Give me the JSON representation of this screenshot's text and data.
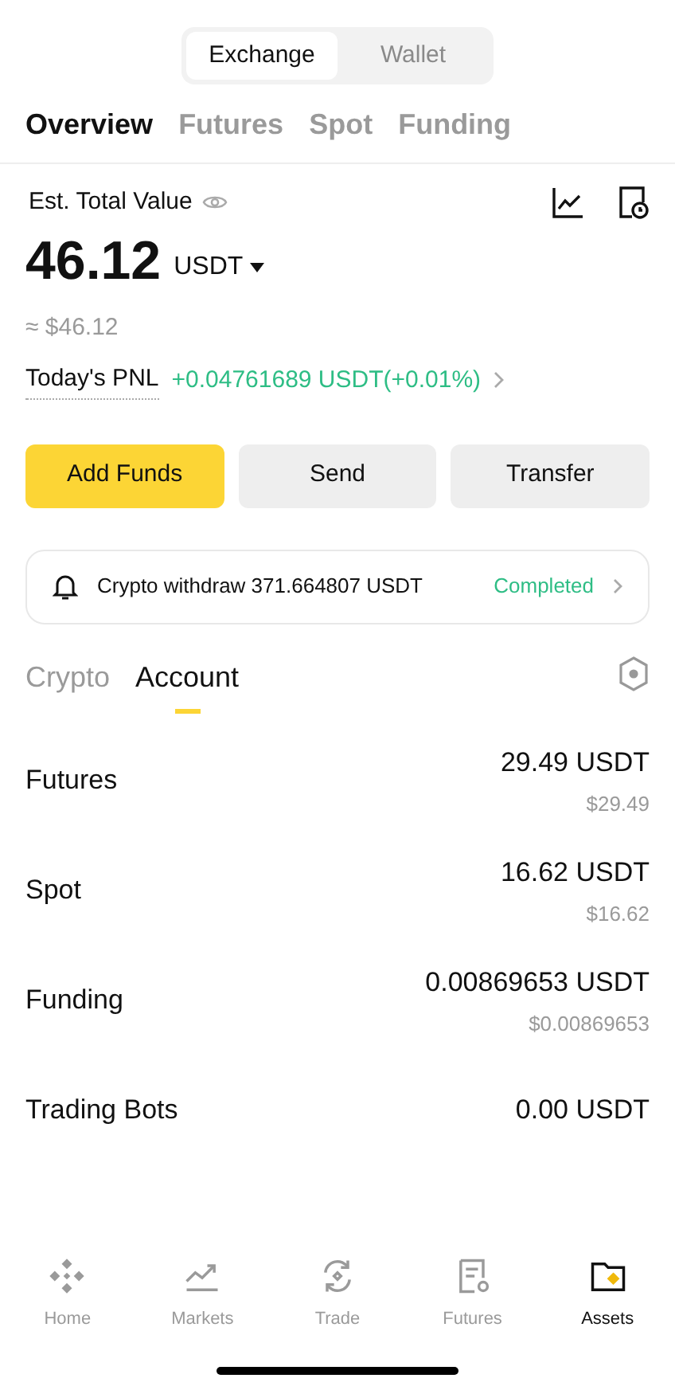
{
  "segments": [
    {
      "label": "Exchange",
      "selected": true
    },
    {
      "label": "Wallet",
      "selected": false
    }
  ],
  "tabs": [
    {
      "label": "Overview",
      "selected": true
    },
    {
      "label": "Futures",
      "selected": false
    },
    {
      "label": "Spot",
      "selected": false
    },
    {
      "label": "Funding",
      "selected": false
    }
  ],
  "summary": {
    "label": "Est. Total Value",
    "value": "46.12",
    "currency": "USDT",
    "approx": "≈ $46.12",
    "pnl_label": "Today's PNL",
    "pnl_value": "+0.04761689 USDT(+0.01%)"
  },
  "actions": [
    {
      "label": "Add Funds",
      "kind": "primary"
    },
    {
      "label": "Send",
      "kind": "secondary"
    },
    {
      "label": "Transfer",
      "kind": "secondary"
    }
  ],
  "notice": {
    "text": "Crypto withdraw 371.664807 USDT",
    "status": "Completed"
  },
  "asset_tabs": [
    {
      "label": "Crypto",
      "selected": false
    },
    {
      "label": "Account",
      "selected": true
    }
  ],
  "accounts": [
    {
      "name": "Futures",
      "amount": "29.49 USDT",
      "usd": "$29.49"
    },
    {
      "name": "Spot",
      "amount": "16.62 USDT",
      "usd": "$16.62"
    },
    {
      "name": "Funding",
      "amount": "0.00869653 USDT",
      "usd": "$0.00869653"
    },
    {
      "name": "Trading Bots",
      "amount": "0.00 USDT"
    }
  ],
  "nav": [
    {
      "label": "Home",
      "kind": "home",
      "selected": false
    },
    {
      "label": "Markets",
      "kind": "markets",
      "selected": false
    },
    {
      "label": "Trade",
      "kind": "trade",
      "selected": false
    },
    {
      "label": "Futures",
      "kind": "futures",
      "selected": false
    },
    {
      "label": "Assets",
      "kind": "assets",
      "selected": true
    }
  ]
}
